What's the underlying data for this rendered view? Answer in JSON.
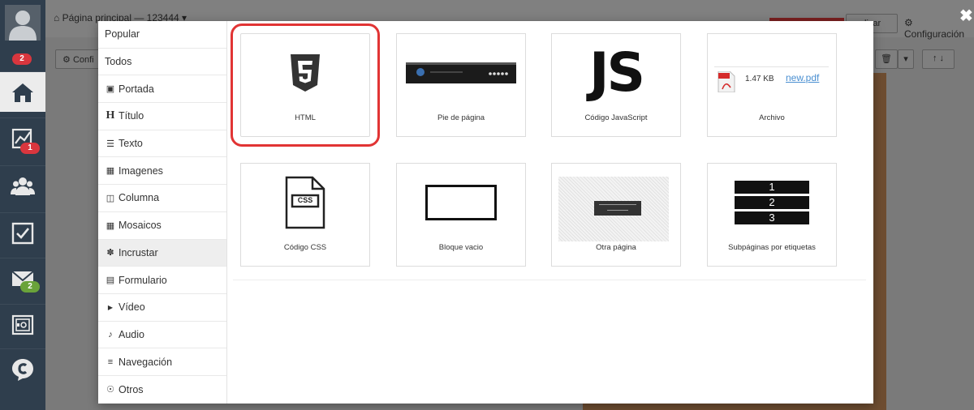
{
  "sidebar": {
    "notifications_badge": "2",
    "stats_badge": "1",
    "mail_badge": "2"
  },
  "background": {
    "breadcrumb": "Página principal — 123444",
    "config_button": "Confi",
    "publish_button": "licar",
    "config_link": "Configuración"
  },
  "menu": {
    "items": [
      {
        "icon": "",
        "label": "Popular"
      },
      {
        "icon": "",
        "label": "Todos"
      },
      {
        "icon": "camera-icon",
        "label": "Portada"
      },
      {
        "icon": "heading-icon",
        "label": "Título"
      },
      {
        "icon": "text-lines-icon",
        "label": "Texto"
      },
      {
        "icon": "image-icon",
        "label": "Imagenes"
      },
      {
        "icon": "columns-icon",
        "label": "Columna"
      },
      {
        "icon": "tiles-icon",
        "label": "Mosaicos"
      },
      {
        "icon": "embed-icon",
        "label": "Incrustar"
      },
      {
        "icon": "form-icon",
        "label": "Formulario"
      },
      {
        "icon": "youtube-icon",
        "label": "Vídeo"
      },
      {
        "icon": "audio-icon",
        "label": "Audio"
      },
      {
        "icon": "navigation-icon",
        "label": "Navegación"
      },
      {
        "icon": "others-icon",
        "label": "Otros"
      }
    ],
    "active_index": 8
  },
  "blocks": [
    {
      "id": "html",
      "label": "HTML",
      "icon": "html5-icon"
    },
    {
      "id": "footer",
      "label": "Pie de página",
      "icon": "footer-preview"
    },
    {
      "id": "js",
      "label": "Código JavaScript",
      "icon": "js-logo",
      "logo_text": "JS"
    },
    {
      "id": "file",
      "label": "Archivo",
      "icon": "pdf-file-icon",
      "file_size": "1.47 KB",
      "file_name": "new.pdf"
    },
    {
      "id": "css",
      "label": "Código CSS",
      "icon": "css-file-icon",
      "css_text": "CSS"
    },
    {
      "id": "empty",
      "label": "Bloque vacio",
      "icon": "empty-block-icon"
    },
    {
      "id": "other",
      "label": "Otra página",
      "icon": "other-page-preview"
    },
    {
      "id": "subpages",
      "label": "Subpáginas por etiquetas",
      "icon": "numbered-list-icon",
      "rows": [
        "1",
        "2",
        "3"
      ]
    }
  ],
  "colors": {
    "selection": "#e13434",
    "sidebar": "#2f3e4d",
    "badge_red": "#d9363e",
    "badge_green": "#6aa33a",
    "link": "#4a8fd1"
  }
}
